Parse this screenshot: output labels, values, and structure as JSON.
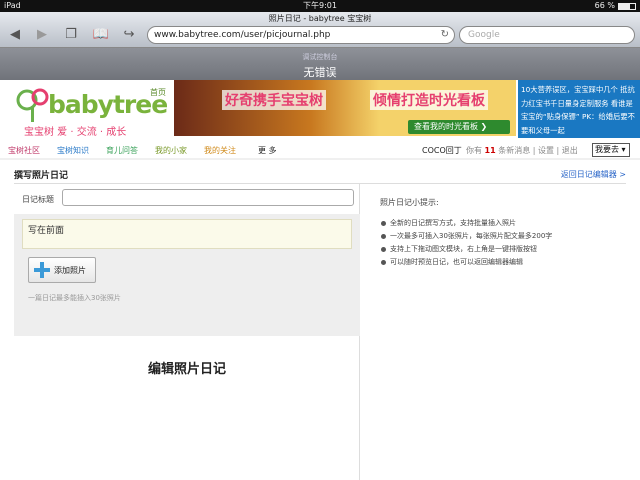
{
  "status_bar": {
    "device": "iPad",
    "time": "下午9:01",
    "battery": "66 %",
    "battery_level": 0.66
  },
  "browser": {
    "page_title": "照片日记 - babytree 宝宝树",
    "url": "www.babytree.com/user/picjournal.php",
    "search_placeholder": "Google"
  },
  "debug_bar": {
    "subtitle": "调试控制台",
    "title": "无错误"
  },
  "header": {
    "logo_text": "babytree",
    "home_link": "首页",
    "slogan": "宝宝树  爱 · 交流 · 成长",
    "banner": {
      "tagline_left": "好奇携手宝宝树",
      "tagline_right": "倾情打造时光看板",
      "cta": "查看我的时光看板 ❯"
    },
    "ad_text": "10大营养误区，宝宝踩中几个 抵抗力红宝书千日量身定制服务 看谁是宝宝的“贴身保镖” PK：给婚后要不要和父母一起"
  },
  "nav": {
    "items": [
      {
        "label": "宝树社区",
        "color": "#c03a6a"
      },
      {
        "label": "宝树知识",
        "color": "#2a7ac8"
      },
      {
        "label": "育儿问答",
        "color": "#3aa25a"
      },
      {
        "label": "我的小家",
        "color": "#7a9a2a"
      },
      {
        "label": "我的关注",
        "color": "#d08a1a"
      },
      {
        "label": "更 多",
        "color": "#222222"
      }
    ],
    "username": "COCO回丁",
    "message_prefix": "你有",
    "message_count": "11",
    "message_suffix": "条新消息 | 设置 | 退出",
    "dropdown": "我要去"
  },
  "page": {
    "heading": "撰写照片日记",
    "back_link": "返回日记编辑器 >",
    "title_label": "日记标题",
    "title_value": "",
    "intro": "写在前面",
    "add_photo": "添加照片",
    "hint": "一篇日记最多能插入30张照片",
    "edit_label": "编辑照片日记"
  },
  "tips": {
    "title": "照片日记小提示:",
    "items": [
      "全新的日记撰写方式，支持批量插入照片",
      "一次最多可插入30张照片，每张照片配文最多200字",
      "支持上下拖动图文模块，右上角是一键排版按钮",
      "可以随时预览日记，也可以返回编辑器编辑"
    ]
  }
}
